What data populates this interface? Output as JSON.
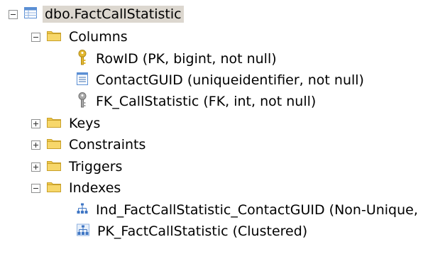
{
  "tree": {
    "table": {
      "label": "dbo.FactCallStatistic",
      "icon": "table-icon",
      "state": "expanded"
    },
    "folders": [
      {
        "label": "Columns",
        "icon": "folder-icon",
        "state": "expanded",
        "children": [
          {
            "label": "RowID (PK, bigint, not null)",
            "icon": "primary-key-icon"
          },
          {
            "label": "ContactGUID (uniqueidentifier, not null)",
            "icon": "column-icon"
          },
          {
            "label": "FK_CallStatistic (FK, int, not null)",
            "icon": "foreign-key-icon"
          }
        ]
      },
      {
        "label": "Keys",
        "icon": "folder-icon",
        "state": "collapsed"
      },
      {
        "label": "Constraints",
        "icon": "folder-icon",
        "state": "collapsed"
      },
      {
        "label": "Triggers",
        "icon": "folder-icon",
        "state": "collapsed"
      },
      {
        "label": "Indexes",
        "icon": "folder-icon",
        "state": "expanded",
        "children": [
          {
            "label": "Ind_FactCallStatistic_ContactGUID (Non-Unique,",
            "icon": "index-icon"
          },
          {
            "label": "PK_FactCallStatistic (Clustered)",
            "icon": "clustered-index-icon"
          }
        ]
      }
    ]
  },
  "colors": {
    "selection": "#dcd7cf",
    "folder": "#f0c94a",
    "table_icon": "#5b8fd4",
    "key_gold": "#e3b830",
    "key_gray": "#9a9a9a",
    "index": "#3f76c4"
  }
}
